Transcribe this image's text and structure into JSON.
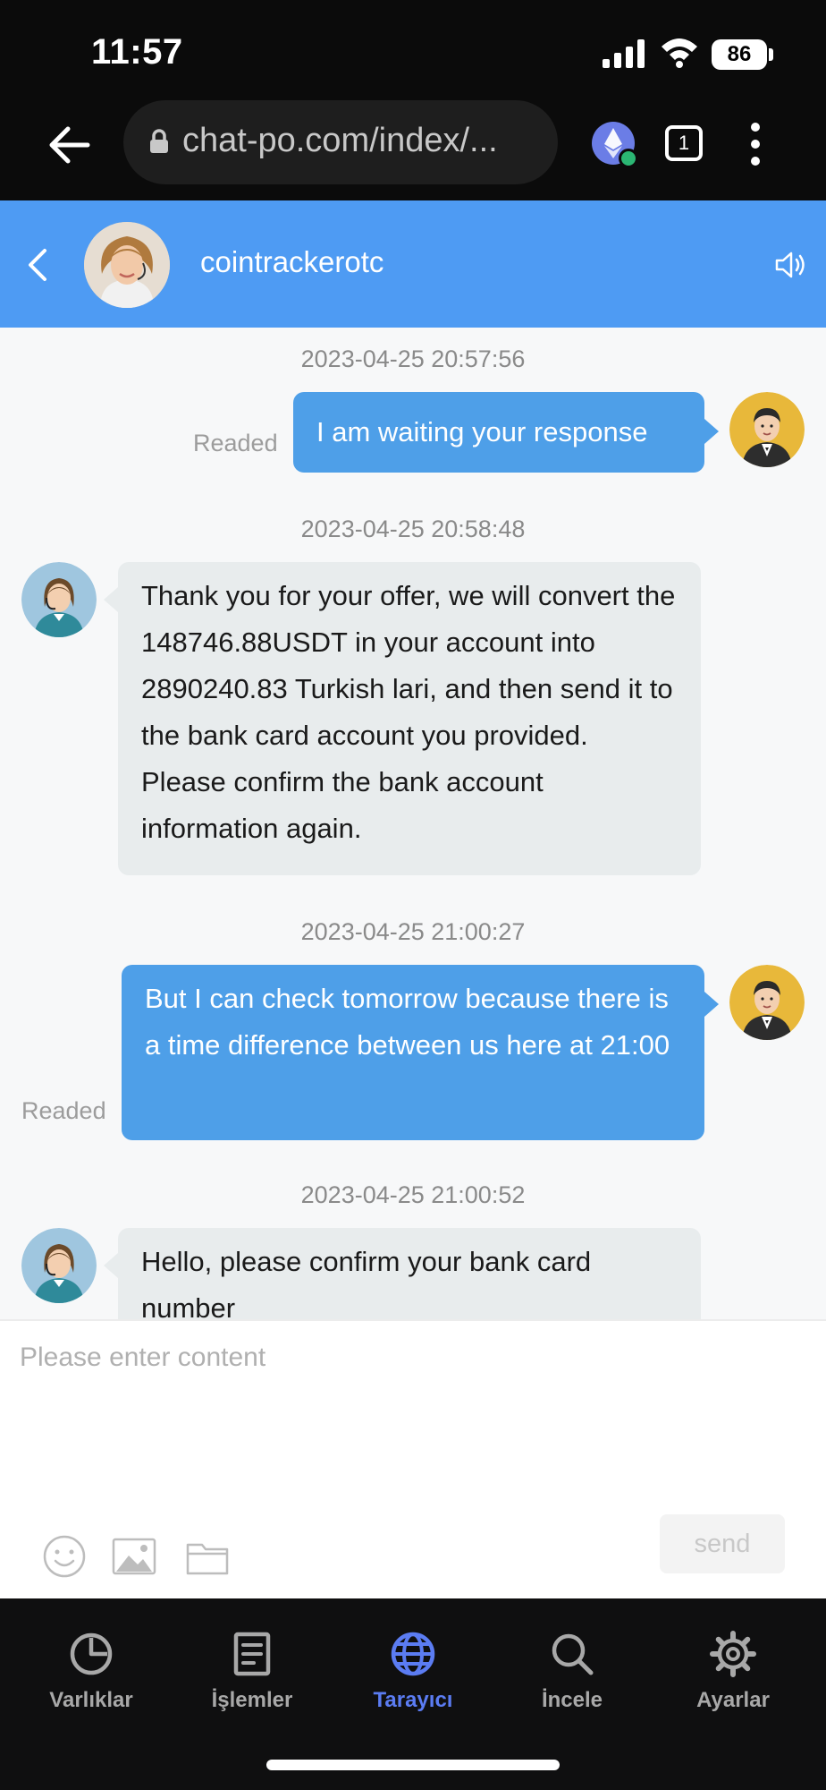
{
  "status_bar": {
    "time": "11:57",
    "battery": "86"
  },
  "browser": {
    "url": "chat-po.com/index/...",
    "tab_count": "1"
  },
  "chat": {
    "contact_name": "cointrackerotc",
    "messages": [
      {
        "timestamp": "2023-04-25 20:57:56",
        "direction": "out",
        "text": "I am waiting your response",
        "status": "Readed"
      },
      {
        "timestamp": "2023-04-25 20:58:48",
        "direction": "in",
        "text": "Thank you for your offer, we will convert the 148746.88USDT in your account into 2890240.83 Turkish lari, and then send it to the bank card account you provided. Please confirm the bank account information again."
      },
      {
        "timestamp": "2023-04-25 21:00:27",
        "direction": "out",
        "text": "But I can check tomorrow because there is a time difference between us here at 21:00",
        "status": "Readed"
      },
      {
        "timestamp": "2023-04-25 21:00:52",
        "direction": "in",
        "text": "Hello, please confirm your bank card number"
      }
    ]
  },
  "composer": {
    "placeholder": "Please enter content",
    "send_label": "send"
  },
  "bottom_nav": {
    "items": [
      {
        "label": "Varlıklar",
        "icon": "pie-chart-icon"
      },
      {
        "label": "İşlemler",
        "icon": "document-list-icon"
      },
      {
        "label": "Tarayıcı",
        "icon": "globe-icon",
        "active": true
      },
      {
        "label": "İncele",
        "icon": "search-icon"
      },
      {
        "label": "Ayarlar",
        "icon": "gear-icon"
      }
    ]
  },
  "colors": {
    "header_blue": "#4e9bf3",
    "outgoing_bubble": "#4e9fe8",
    "incoming_bubble": "#e8eced",
    "nav_active": "#5b7cf2"
  }
}
